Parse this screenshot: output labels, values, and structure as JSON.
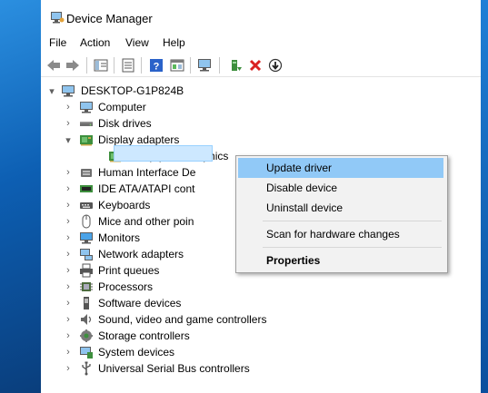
{
  "window": {
    "title": "Device Manager"
  },
  "menu": [
    "File",
    "Action",
    "View",
    "Help"
  ],
  "toolbar": [
    {
      "name": "back-icon"
    },
    {
      "name": "forward-icon"
    },
    {
      "name": "show-hide-tree-icon"
    },
    {
      "name": "properties-icon"
    },
    {
      "name": "help-icon"
    },
    {
      "name": "view-icon"
    },
    {
      "name": "scan-hardware-icon"
    },
    {
      "name": "update-driver-icon"
    },
    {
      "name": "uninstall-icon"
    },
    {
      "name": "disable-icon"
    }
  ],
  "tree": {
    "root": "DESKTOP-G1P824B",
    "items": [
      {
        "label": "Computer",
        "icon": "computer-icon",
        "expanded": false
      },
      {
        "label": "Disk drives",
        "icon": "disk-drive-icon",
        "expanded": false
      },
      {
        "label": "Display adapters",
        "icon": "display-adapter-icon",
        "expanded": true
      },
      {
        "label": "Intel(R) HD Graphics",
        "icon": "display-adapter-icon",
        "child": true,
        "selected": true
      },
      {
        "label": "Human Interface De",
        "icon": "hid-icon",
        "expanded": false
      },
      {
        "label": "IDE ATA/ATAPI cont",
        "icon": "ide-icon",
        "expanded": false
      },
      {
        "label": "Keyboards",
        "icon": "keyboard-icon",
        "expanded": false
      },
      {
        "label": "Mice and other poin",
        "icon": "mouse-icon",
        "expanded": false
      },
      {
        "label": "Monitors",
        "icon": "monitor-icon",
        "expanded": false
      },
      {
        "label": "Network adapters",
        "icon": "network-adapter-icon",
        "expanded": false
      },
      {
        "label": "Print queues",
        "icon": "printer-icon",
        "expanded": false
      },
      {
        "label": "Processors",
        "icon": "processor-icon",
        "expanded": false
      },
      {
        "label": "Software devices",
        "icon": "software-device-icon",
        "expanded": false
      },
      {
        "label": "Sound, video and game controllers",
        "icon": "sound-icon",
        "expanded": false
      },
      {
        "label": "Storage controllers",
        "icon": "storage-controller-icon",
        "expanded": false
      },
      {
        "label": "System devices",
        "icon": "system-device-icon",
        "expanded": false
      },
      {
        "label": "Universal Serial Bus controllers",
        "icon": "usb-icon",
        "expanded": false
      }
    ]
  },
  "context_menu": {
    "update_driver": "Update driver",
    "disable_device": "Disable device",
    "uninstall_device": "Uninstall device",
    "scan": "Scan for hardware changes",
    "properties": "Properties"
  },
  "colors": {
    "selection": "#cde8ff",
    "menu_highlight": "#91c9f7",
    "desktop": "#1565a8"
  }
}
